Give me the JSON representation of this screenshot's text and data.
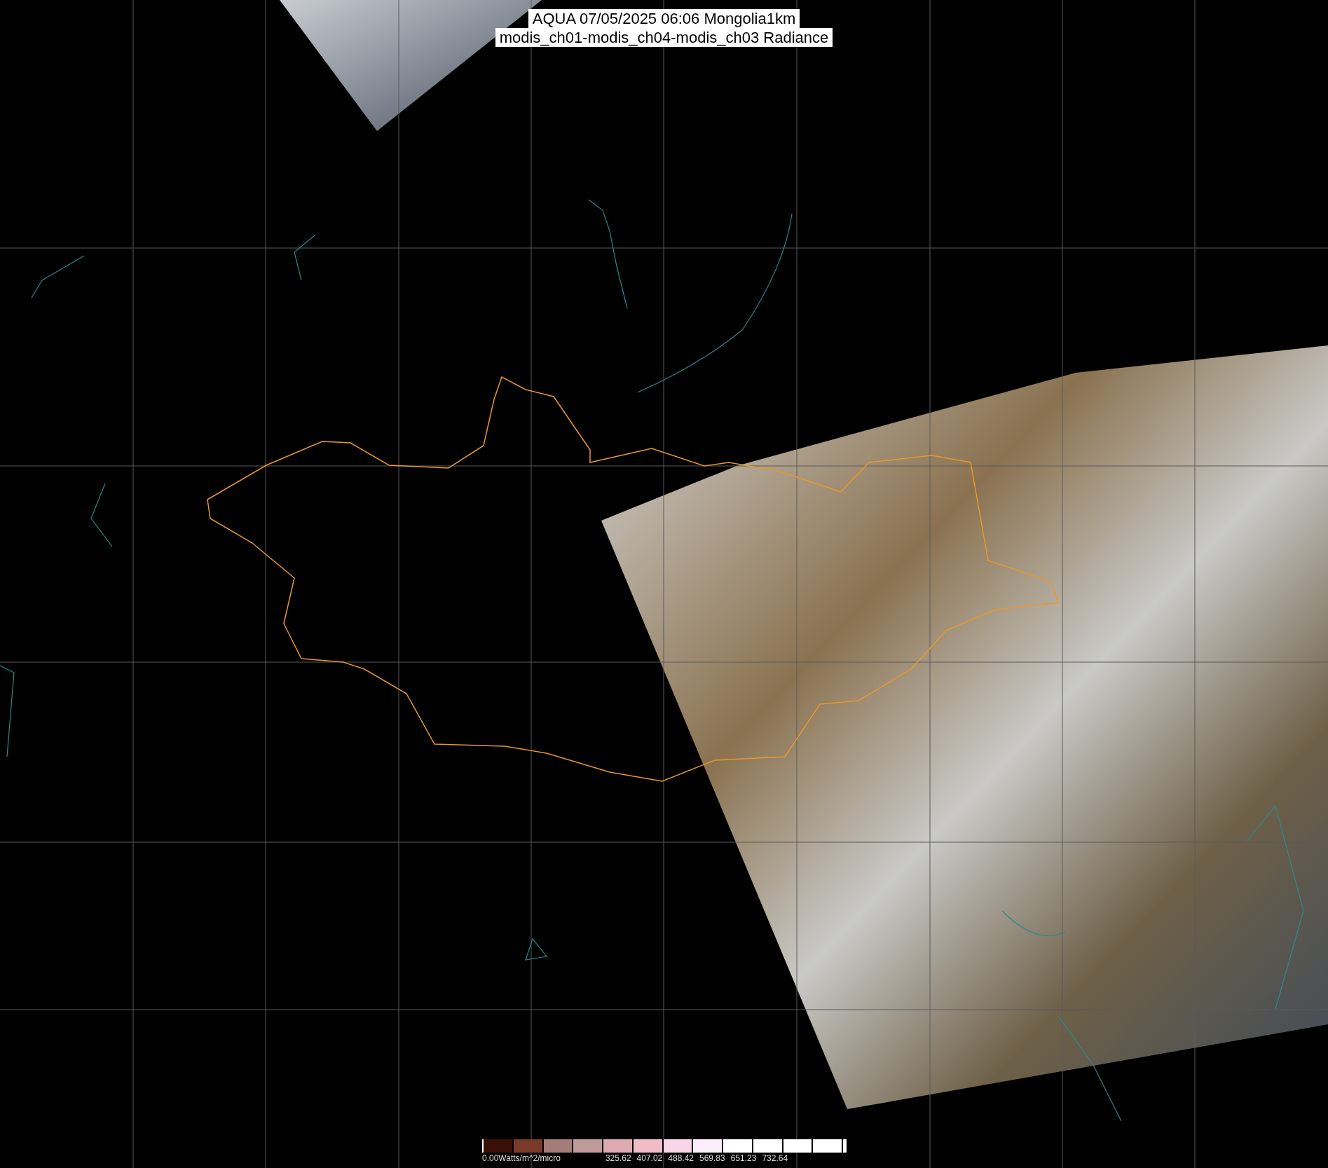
{
  "title": {
    "lines": [
      "AQUA 07/05/2025 06:06 Mongolia1km",
      "modis_ch01-modis_ch04-modis_ch03 Radiance"
    ]
  },
  "colorbar": {
    "unit_label": "0.00Watts/m^2/micro",
    "tick_labels": [
      "325.62",
      "407.02",
      "488.42",
      "569.83",
      "651.23",
      "732.64"
    ]
  }
}
